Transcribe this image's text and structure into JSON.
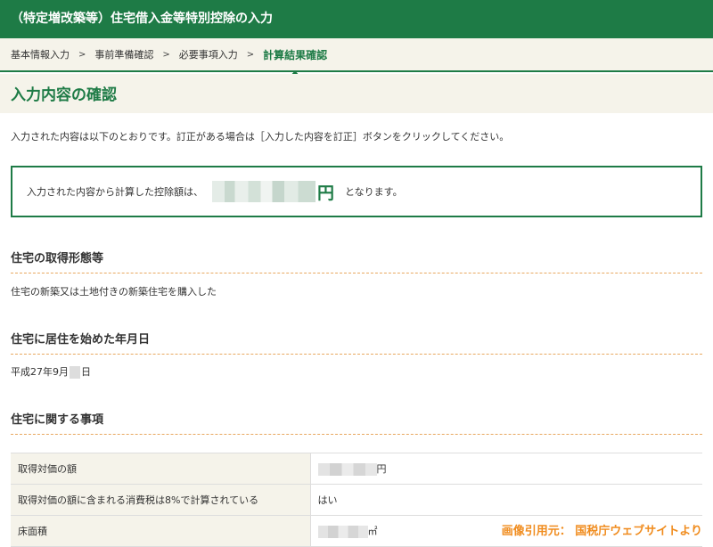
{
  "titlebar": {
    "title": "（特定増改築等）住宅借入金等特別控除の入力"
  },
  "breadcrumb": {
    "items": [
      "基本情報入力",
      "事前準備確認",
      "必要事項入力",
      "計算結果確認"
    ],
    "separator": ">"
  },
  "page": {
    "title": "入力内容の確認"
  },
  "intro": "入力された内容は以下のとおりです。訂正がある場合は［入力した内容を訂正］ボタンをクリックしてください。",
  "result": {
    "prefix": "入力された内容から計算した控除額は、",
    "unit": "円",
    "suffix": "となります。"
  },
  "sections": {
    "acquisition": {
      "heading": "住宅の取得形態等",
      "value": "住宅の新築又は土地付きの新築住宅を購入した"
    },
    "residence": {
      "heading": "住宅に居住を始めた年月日",
      "value_prefix": "平成27年9月",
      "value_suffix": "日"
    },
    "housing": {
      "heading": "住宅に関する事項",
      "rows": [
        {
          "label": "取得対価の額",
          "value_unit": "円"
        },
        {
          "label": "取得対価の額に含まれる消費税は8%で計算されている",
          "value": "はい"
        },
        {
          "label": "床面積",
          "value_unit": "㎡"
        }
      ]
    }
  },
  "credit": "画像引用元： 国税庁ウェブサイトより",
  "colors": {
    "brand_green": "#1e7b46",
    "accent_orange": "#f08c1e",
    "panel_beige": "#f5f3ea"
  }
}
